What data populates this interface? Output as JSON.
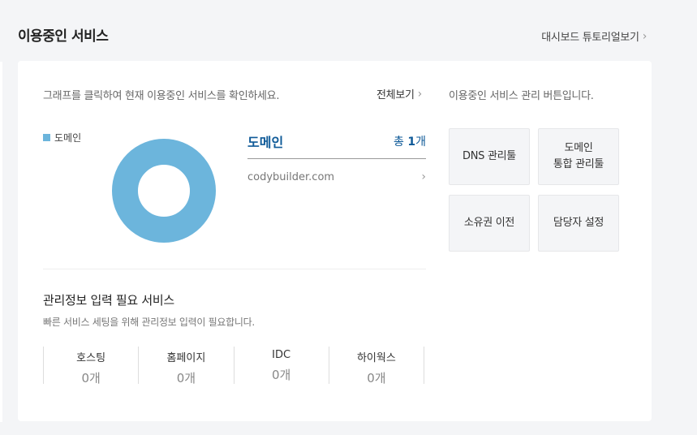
{
  "header": {
    "title": "이용중인 서비스",
    "tutorial_link": "대시보드 튜토리얼보기"
  },
  "overview": {
    "intro": "그래프를 클릭하여 현재 이용중인 서비스를 확인하세요.",
    "view_all": "전체보기",
    "legend": [
      {
        "label": "도메인",
        "color": "#6cb5dc"
      }
    ],
    "chart_data": {
      "type": "pie",
      "categories": [
        "도메인"
      ],
      "values": [
        1
      ],
      "colors": [
        "#6cb5dc"
      ],
      "donut": true
    },
    "domain_panel": {
      "title": "도메인",
      "count_prefix": "총",
      "count_value": "1",
      "count_suffix": "개",
      "items": [
        "codybuilder.com"
      ]
    }
  },
  "required_info": {
    "title": "관리정보 입력 필요 서비스",
    "subtitle": "빠른 서비스 세팅을 위해 관리정보 입력이 필요합니다.",
    "stats": [
      {
        "label": "호스팅",
        "value": "0개"
      },
      {
        "label": "홈페이지",
        "value": "0개"
      },
      {
        "label": "IDC",
        "value": "0개"
      },
      {
        "label": "하이웍스",
        "value": "0개"
      }
    ]
  },
  "management": {
    "description": "이용중인 서비스 관리 버튼입니다.",
    "buttons": [
      {
        "label": "DNS 관리툴"
      },
      {
        "label": "도메인\n통합 관리툴"
      },
      {
        "label": "소유권 이전"
      },
      {
        "label": "담당자 설정"
      }
    ]
  },
  "icons": {
    "chevron": "chevron-right-icon"
  }
}
